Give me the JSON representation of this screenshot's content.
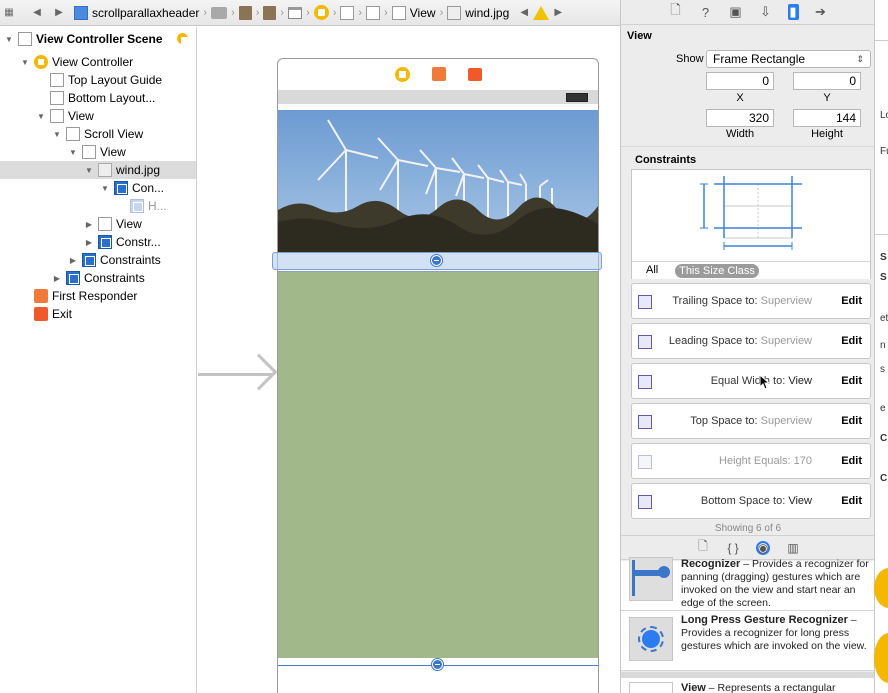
{
  "jumpbar": {
    "project": "scrollparallaxheader",
    "crumb_view": "View",
    "crumb_image": "wind.jpg"
  },
  "outline": {
    "items": [
      {
        "label": "View Controller Scene"
      },
      {
        "label": "View Controller"
      },
      {
        "label": "Top Layout Guide"
      },
      {
        "label": "Bottom Layout..."
      },
      {
        "label": "View"
      },
      {
        "label": "Scroll View"
      },
      {
        "label": "View"
      },
      {
        "label": "wind.jpg"
      },
      {
        "label": "Con..."
      },
      {
        "label": "H..."
      },
      {
        "label": "View"
      },
      {
        "label": "Constr..."
      },
      {
        "label": "Constraints"
      },
      {
        "label": "Constraints"
      },
      {
        "label": "First Responder"
      },
      {
        "label": "Exit"
      }
    ]
  },
  "inspector": {
    "section_title": "View",
    "show_label": "Show",
    "show_value": "Frame Rectangle",
    "x": "0",
    "y": "0",
    "x_label": "X",
    "y_label": "Y",
    "width": "320",
    "height": "144",
    "width_label": "Width",
    "height_label": "Height",
    "constraints_title": "Constraints",
    "seg_all": "All",
    "seg_sizeclass": "This Size Class",
    "constraints": [
      {
        "key": "Trailing Space to:",
        "value": "Superview",
        "edit": "Edit"
      },
      {
        "key": "Leading Space to:",
        "value": "Superview",
        "edit": "Edit"
      },
      {
        "key": "Equal Width to:",
        "value": "View",
        "edit": "Edit"
      },
      {
        "key": "Top Space to:",
        "value": "Superview",
        "edit": "Edit"
      },
      {
        "key": "Height Equals:",
        "value": "170",
        "edit": "Edit"
      },
      {
        "key": "Bottom Space to:",
        "value": "View",
        "edit": "Edit"
      }
    ],
    "showing": "Showing 6 of 6"
  },
  "library": {
    "items": [
      {
        "title": "Recognizer",
        "desc": " – Provides a recognizer for panning (dragging) gestures which are invoked on the view and start near an edge of the screen."
      },
      {
        "title": "Long Press Gesture Recognizer",
        "desc": " – Provides a recognizer for long press gestures which are invoked on the view."
      },
      {
        "title": "View",
        "desc": " – Represents a rectangular"
      }
    ]
  },
  "rstrip": {
    "t1": "Lo",
    "t2": "Fu",
    "t3": "S",
    "t4": "S",
    "t5": "ett",
    "t6": "n",
    "t7": "s",
    "t8": "e",
    "t9": "C",
    "t10": "C"
  },
  "colors": {
    "accent": "#2b7cf0",
    "canvas_green": "#a1b98a",
    "selection": "#dcdcdc",
    "constraint_blue": "#2a6fc9"
  }
}
